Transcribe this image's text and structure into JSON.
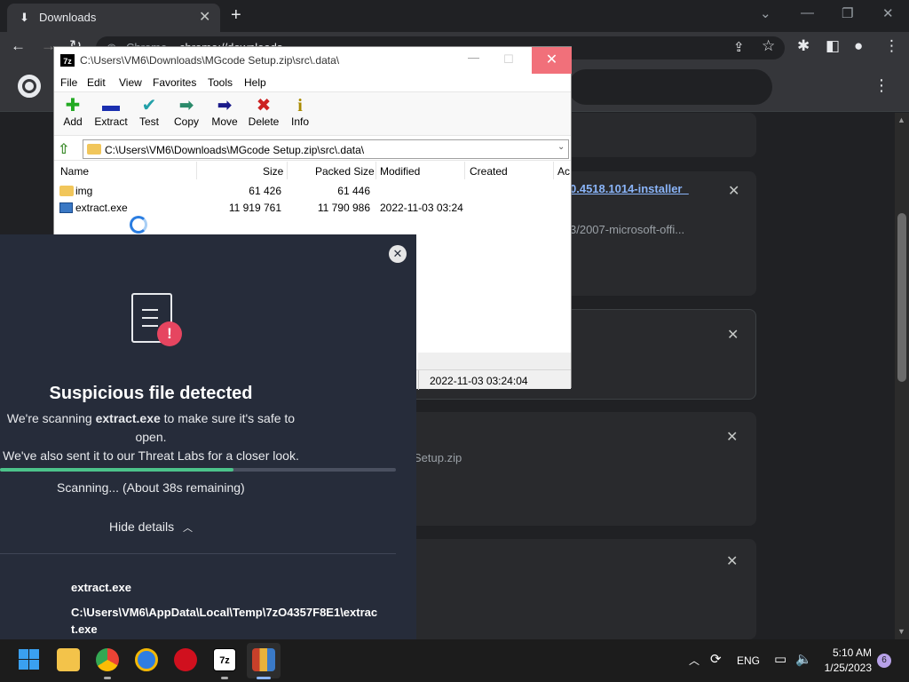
{
  "browser": {
    "tab_title": "Downloads",
    "address": "chrome://downloads",
    "address_prefix": "Chrome"
  },
  "downloads_page": {
    "items": [
      {
        "link_fragment": "0.4518.1014-installer_",
        "sub_fragment": "3/2007-microsoft-offi..."
      },
      {
        "link_fragment": "",
        "sub_fragment": ""
      },
      {
        "link_fragment": "",
        "sub_fragment": "Setup.zip"
      },
      {
        "link_fragment": "",
        "sub_fragment": ""
      }
    ]
  },
  "sevenzip": {
    "title": "C:\\Users\\VM6\\Downloads\\MGcode Setup.zip\\src\\.data\\",
    "logo": "7z",
    "menu": [
      "File",
      "Edit",
      "View",
      "Favorites",
      "Tools",
      "Help"
    ],
    "tools": [
      {
        "label": "Add",
        "icon": "plus-icon",
        "glyph": "✚",
        "color": "#22aa22"
      },
      {
        "label": "Extract",
        "icon": "minus-icon",
        "glyph": "▬",
        "color": "#1a2fb0"
      },
      {
        "label": "Test",
        "icon": "check-icon",
        "glyph": "✔",
        "color": "#22a0a8"
      },
      {
        "label": "Copy",
        "icon": "arrow-right-icon",
        "glyph": "➡",
        "color": "#2a8a6a"
      },
      {
        "label": "Move",
        "icon": "arrow-right-blue-icon",
        "glyph": "➡",
        "color": "#1a1a8a"
      },
      {
        "label": "Delete",
        "icon": "x-icon",
        "glyph": "✖",
        "color": "#cc2222"
      },
      {
        "label": "Info",
        "icon": "info-icon",
        "glyph": "i",
        "color": "#a88a00"
      }
    ],
    "address": "C:\\Users\\VM6\\Downloads\\MGcode Setup.zip\\src\\.data\\",
    "columns": [
      "Name",
      "Size",
      "Packed Size",
      "Modified",
      "Created",
      "Ac"
    ],
    "files": [
      {
        "name": "img",
        "size": "61 426",
        "packed": "61 446",
        "modified": "",
        "type": "folder"
      },
      {
        "name": "extract.exe",
        "size": "11 919 761",
        "packed": "11 790 986",
        "modified": "2022-11-03 03:24",
        "type": "exe"
      }
    ],
    "status_modified": "2022-11-03 03:24:04"
  },
  "threat_panel": {
    "heading": "Suspicious file detected",
    "desc_line1_pre": "We're scanning ",
    "desc_line1_file": "extract.exe",
    "desc_line1_post": " to make sure it's safe to open.",
    "desc_line2": "We've also sent it to our Threat Labs for a closer look.",
    "progress": 0.59,
    "scanning": "Scanning... (About 38s remaining)",
    "hide_details": "Hide details",
    "file_name": "extract.exe",
    "file_path": "C:\\Users\\VM6\\AppData\\Local\\Temp\\7zO4357F8E1\\extract.exe"
  },
  "taskbar": {
    "language": "ENG",
    "time": "5:10 AM",
    "date": "1/25/2023",
    "badge": "6"
  }
}
